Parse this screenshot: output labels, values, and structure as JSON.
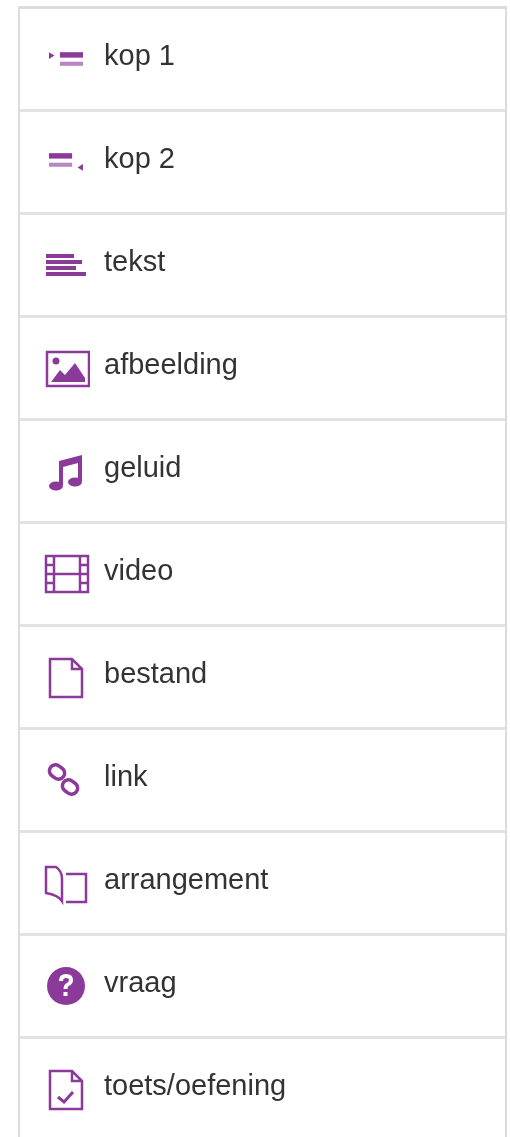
{
  "items": [
    {
      "kind": "heading1",
      "label": "kop 1"
    },
    {
      "kind": "heading2",
      "label": "kop 2"
    },
    {
      "kind": "text",
      "label": "tekst"
    },
    {
      "kind": "image",
      "label": "afbeelding"
    },
    {
      "kind": "audio",
      "label": "geluid"
    },
    {
      "kind": "video",
      "label": "video"
    },
    {
      "kind": "file",
      "label": "bestand"
    },
    {
      "kind": "link",
      "label": "link"
    },
    {
      "kind": "arrangement",
      "label": "arrangement"
    },
    {
      "kind": "question",
      "label": "vraag"
    },
    {
      "kind": "test",
      "label": "toets/oefening"
    }
  ]
}
